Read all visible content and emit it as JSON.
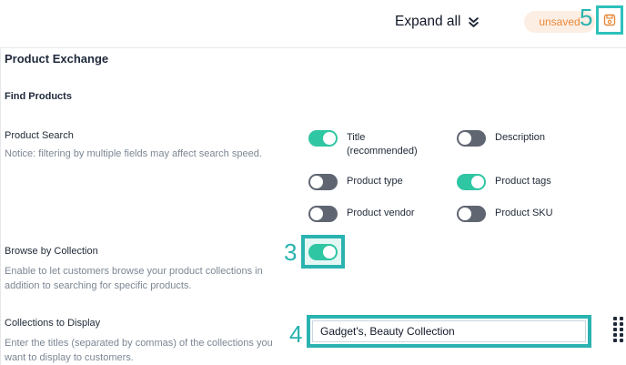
{
  "header": {
    "expand_all_label": "Expand all",
    "status_badge": "unsaved",
    "callout_save": "5"
  },
  "section": {
    "title": "Product Exchange",
    "subtitle": "Find Products"
  },
  "product_search": {
    "title": "Product Search",
    "description": "Notice: filtering by multiple fields may affect search speed.",
    "options": [
      {
        "label": "Title (recommended)",
        "enabled": true
      },
      {
        "label": "Description",
        "enabled": false
      },
      {
        "label": "Product type",
        "enabled": false
      },
      {
        "label": "Product tags",
        "enabled": true
      },
      {
        "label": "Product vendor",
        "enabled": false
      },
      {
        "label": "Product SKU",
        "enabled": false
      }
    ]
  },
  "browse_by_collection": {
    "title": "Browse by Collection",
    "description": "Enable to let customers browse your product collections in addition to searching for specific products.",
    "enabled": true,
    "callout": "3"
  },
  "collections_to_display": {
    "title": "Collections to Display",
    "description": "Enter the titles (separated by commas) of the collections you want to display to customers.",
    "value": "Gadget's, Beauty Collection",
    "callout": "4"
  },
  "colors": {
    "accent": "#2ab3b0",
    "toggle_on": "#2fc6a3",
    "toggle_off": "#5f6571",
    "badge_bg": "#fdeee3",
    "badge_text": "#e8893b"
  }
}
